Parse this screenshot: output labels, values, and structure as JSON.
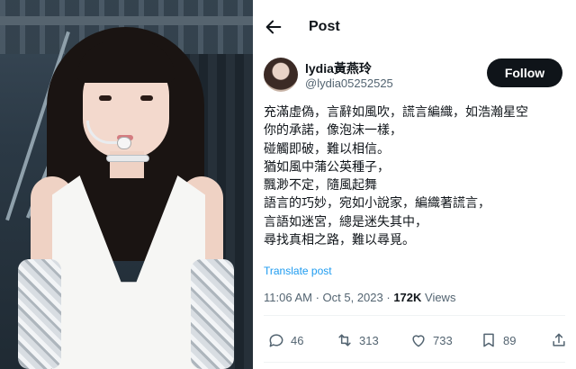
{
  "header": {
    "title": "Post"
  },
  "author": {
    "name": "lydia黃燕玲",
    "handle": "@lydia05252525"
  },
  "follow_label": "Follow",
  "post": {
    "lines": [
      "充滿虛偽，言辭如風吹，謊言編織，如浩瀚星空",
      "你的承諾，像泡沫一樣，",
      "碰觸即破，難以相信。",
      "猶如風中蒲公英種子，",
      "飄渺不定，隨風起舞",
      "語言的巧妙，宛如小說家，編織著謊言，",
      "言語如迷宮，總是迷失其中，",
      "尋找真相之路，難以尋覓。"
    ],
    "translate_label": "Translate post"
  },
  "meta": {
    "time": "11:06 AM",
    "sep": " · ",
    "date": "Oct 5, 2023",
    "sep2": " · ",
    "views_count": "172K",
    "views_label": " Views"
  },
  "actions": {
    "replies": "46",
    "reposts": "313",
    "likes": "733",
    "bookmarks": "89"
  },
  "icons": [
    "back-arrow-icon",
    "reply-icon",
    "repost-icon",
    "like-icon",
    "bookmark-icon",
    "share-icon"
  ],
  "colors": {
    "link": "#1d9bf0",
    "muted": "#536471",
    "text": "#0f1419",
    "follow_bg": "#0f1419"
  }
}
